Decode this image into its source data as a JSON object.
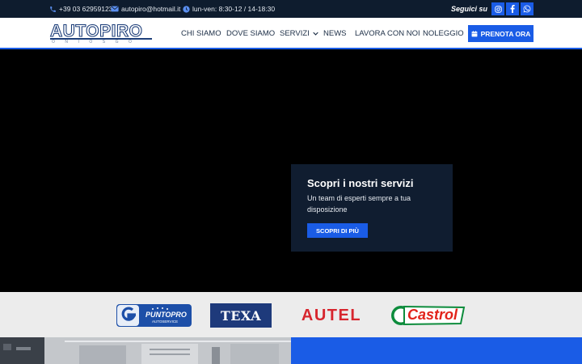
{
  "topbar": {
    "phone": "+39 03 62959123",
    "email": "autopiro@hotmail.it",
    "hours": "lun-ven: 8:30-12 / 14-18:30",
    "follow_label": "Seguici su",
    "social": [
      "instagram-icon",
      "facebook-icon",
      "whatsapp-icon"
    ]
  },
  "header": {
    "logo_text": "AUTOPIRO",
    "logo_sub": "ONIOSGO",
    "nav": {
      "chi_siamo": "CHI SIAMO",
      "dove_siamo": "DOVE SIAMO",
      "servizi": "SERVIZI",
      "news": "NEWS",
      "lavora": "LAVORA CON NOI",
      "noleggio": "NOLEGGIO"
    },
    "cta_label": "PRENOTA ORA"
  },
  "hero": {
    "card_title": "Scopri i nostri servizi",
    "card_subtitle": "Un team di esperti sempre a tua disposizione",
    "card_button": "SCOPRI DI PIÙ"
  },
  "partners": {
    "puntopro_top": "PUNTOPRO",
    "puntopro_bottom": "AUTOSERVICE",
    "texa": "TEXA",
    "autel": "AUTEL",
    "castrol": "Castrol"
  },
  "colors": {
    "accent": "#1a5ce6",
    "topbar_bg": "#0e1c2e",
    "card_bg": "#101d30",
    "autel_red": "#d7262e",
    "castrol_green": "#0d8c3c",
    "castrol_red": "#e2231a"
  }
}
